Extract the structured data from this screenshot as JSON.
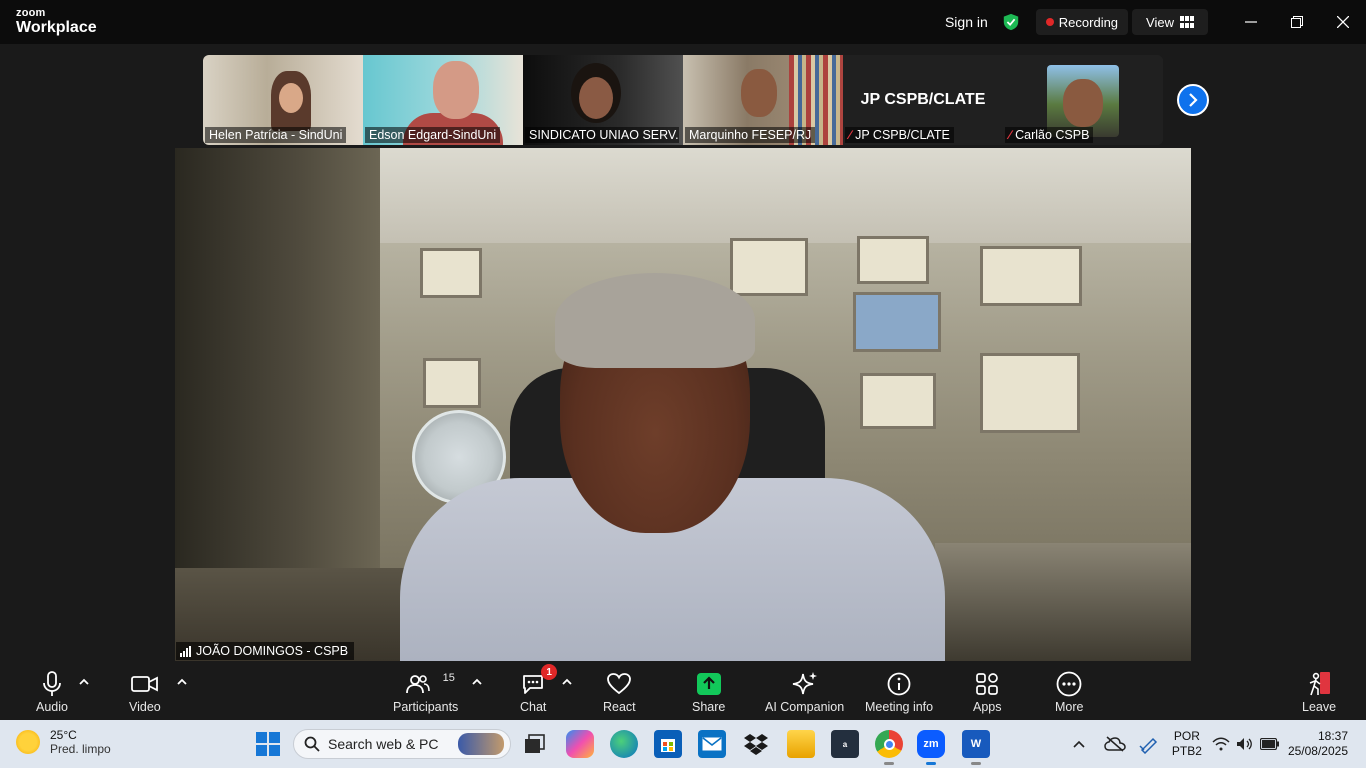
{
  "titlebar": {
    "brand_top": "zoom",
    "brand_bottom": "Workplace",
    "sign_in": "Sign in",
    "recording": "Recording",
    "view": "View"
  },
  "filmstrip": {
    "tiles": [
      {
        "name": "Helen Patrícia - SindUni",
        "muted": false
      },
      {
        "name": "Edson Edgard-SindUni",
        "muted": false
      },
      {
        "name": "SINDICATO UNIAO SERV...",
        "muted": false
      },
      {
        "name": "Marquinho FESEP/RJ",
        "muted": false
      },
      {
        "name": "JP CSPB/CLATE",
        "big_name": "JP CSPB/CLATE",
        "muted": true
      },
      {
        "name": "Carlão CSPB",
        "muted": true
      }
    ]
  },
  "main_video": {
    "speaker_name": "JOÃO DOMINGOS - CSPB"
  },
  "toolbar": {
    "audio": "Audio",
    "video": "Video",
    "participants": "Participants",
    "participants_count": "15",
    "chat": "Chat",
    "chat_badge": "1",
    "react": "React",
    "share": "Share",
    "ai_companion": "AI Companion",
    "meeting_info": "Meeting info",
    "apps": "Apps",
    "more": "More",
    "leave": "Leave"
  },
  "taskbar": {
    "weather_temp": "25°C",
    "weather_desc": "Pred. limpo",
    "search_placeholder": "Search web & PC",
    "lang_top": "POR",
    "lang_bottom": "PTB2",
    "time": "18:37",
    "date": "25/08/2025"
  },
  "colors": {
    "accent_blue": "#0e72ed",
    "share_green": "#12c85a",
    "record_red": "#e02828",
    "shield_green": "#1db954"
  }
}
